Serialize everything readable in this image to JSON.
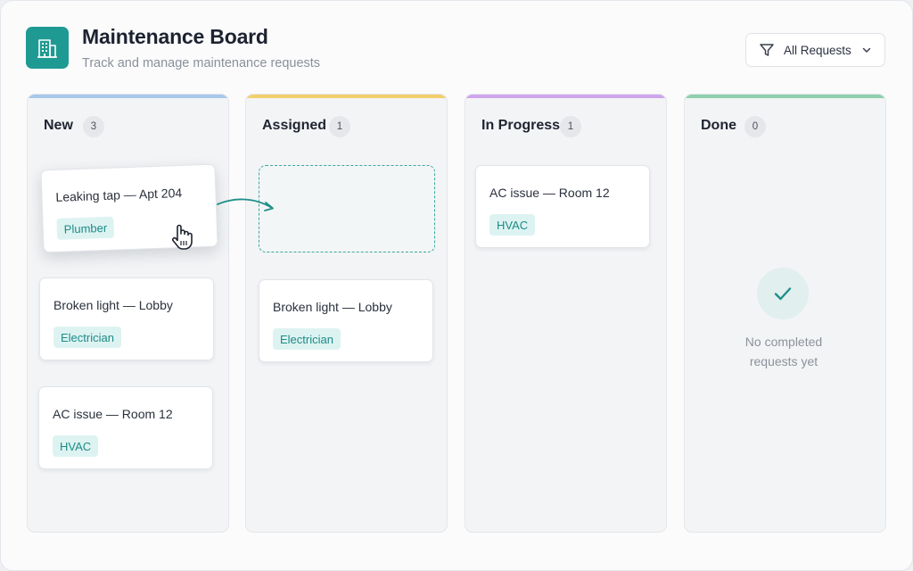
{
  "header": {
    "title": "Maintenance Board",
    "subtitle": "Track and manage maintenance requests",
    "app_icon": "building-icon"
  },
  "filter": {
    "label": "All Requests",
    "icon": "filter-icon",
    "chevron": "chevron-down-icon"
  },
  "colors": {
    "accent": "#1f9a93",
    "new": "#a8c8ea",
    "assigned": "#f3cf6b",
    "in_progress": "#cfa6ec",
    "done": "#8fcfae",
    "tag_bg": "#ddf3f2",
    "tag_text": "#1c8b86"
  },
  "columns": {
    "new": {
      "title": "New",
      "count": "3",
      "cards": [
        {
          "title": "Leaking tap — Apt 204",
          "tag": "Plumber"
        },
        {
          "title": "Broken light — Lobby",
          "tag": "Electrician"
        },
        {
          "title": "AC issue — Room 12",
          "tag": "HVAC"
        }
      ]
    },
    "assigned": {
      "title": "Assigned",
      "count": "1",
      "cards": [
        {
          "title": "Broken light — Lobby",
          "tag": "Electrician"
        }
      ]
    },
    "in_progress": {
      "title": "In Progress",
      "count": "1",
      "cards": [
        {
          "title": "AC issue — Room 12",
          "tag": "HVAC"
        }
      ]
    },
    "done": {
      "title": "Done",
      "count": "0",
      "cards": [],
      "empty_line1": "No completed",
      "empty_line2": "requests yet",
      "empty_icon": "check-icon"
    }
  }
}
